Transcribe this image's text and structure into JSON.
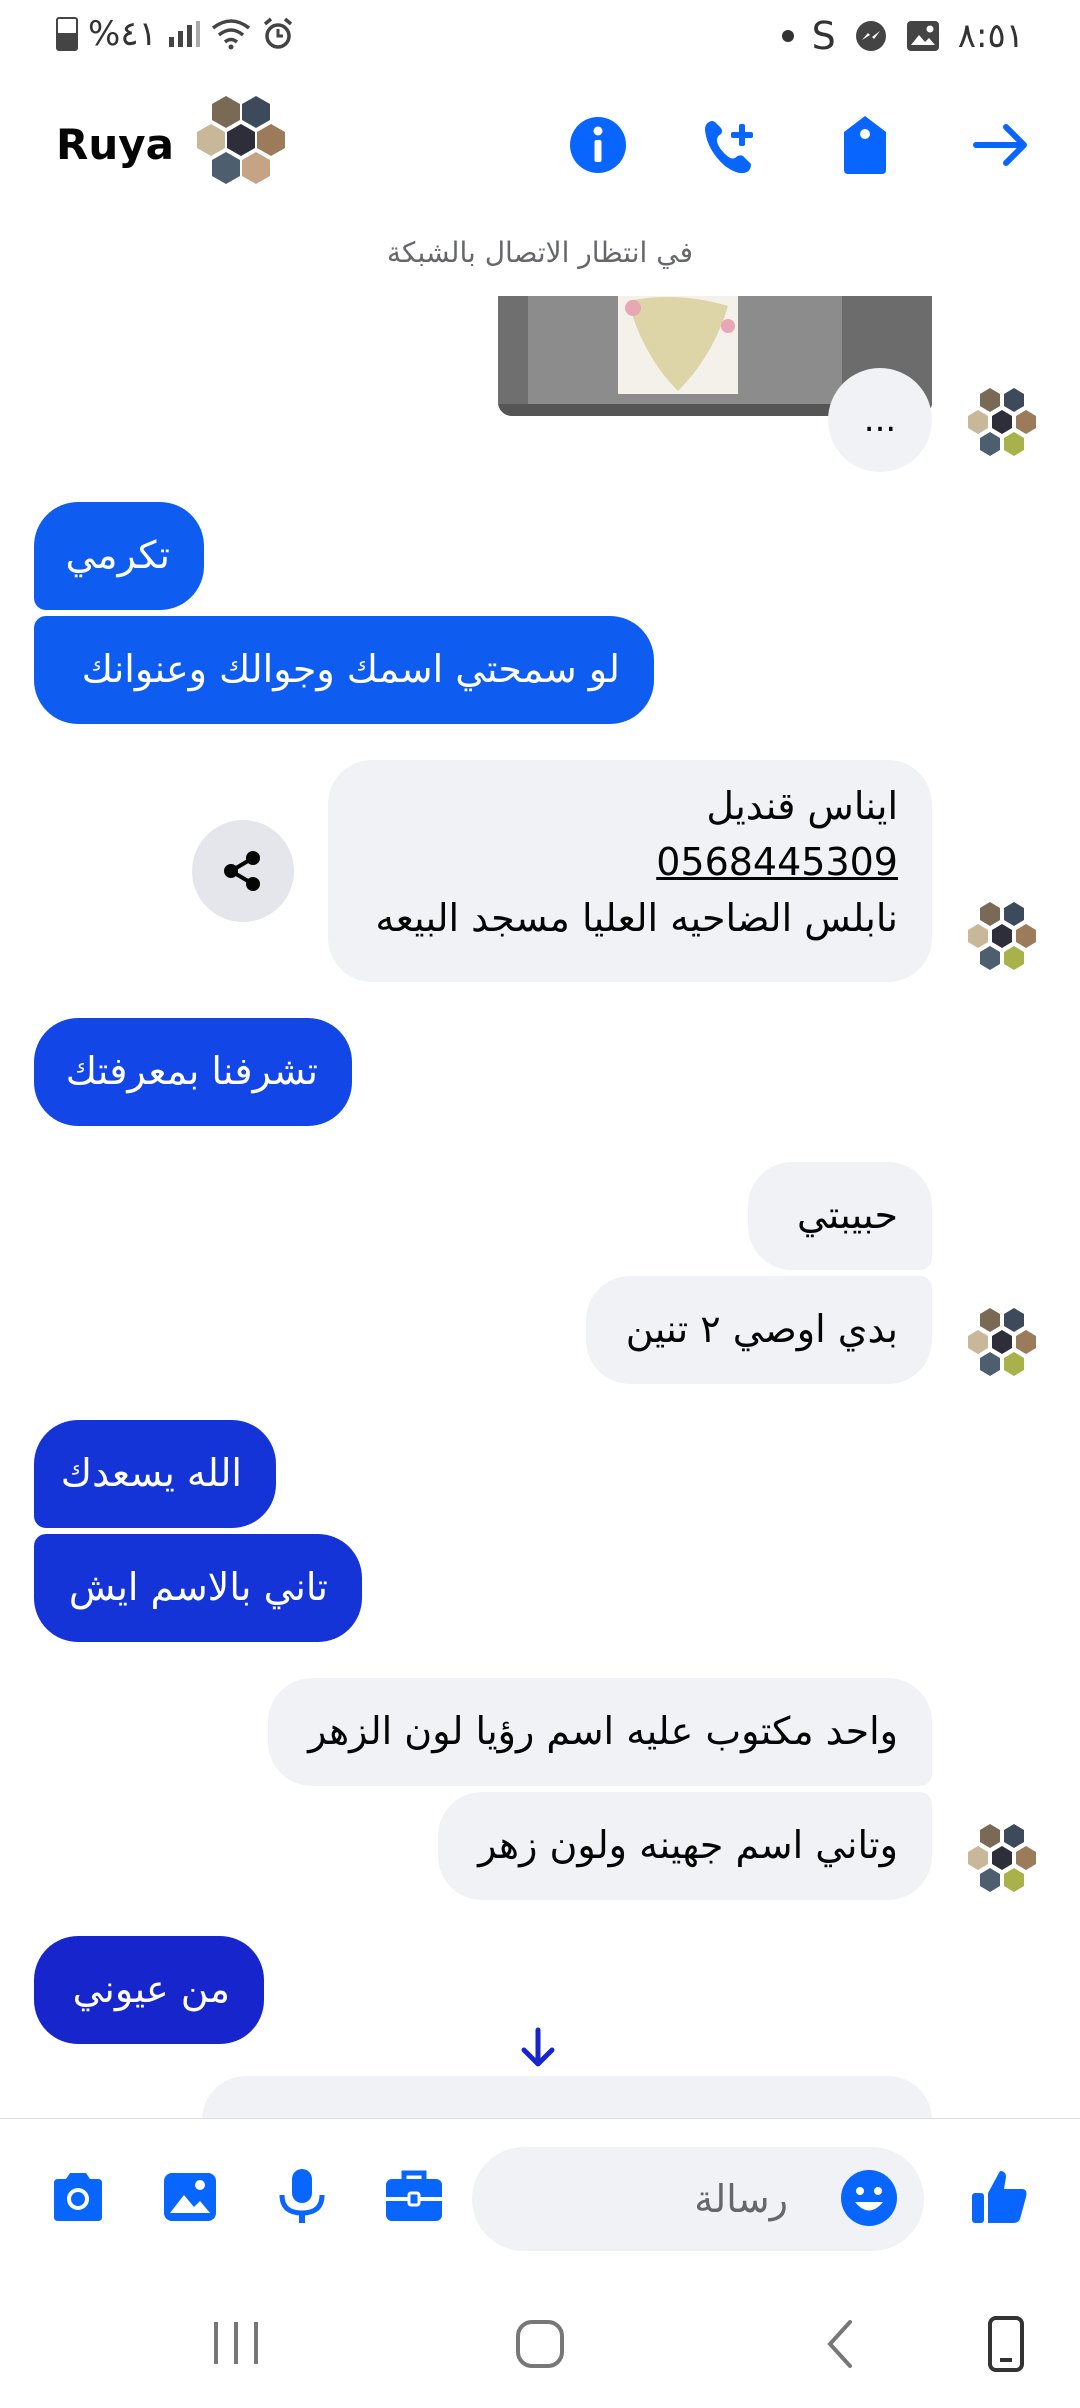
{
  "status_bar": {
    "battery_percent": "%٤١",
    "time": "٨:٥١",
    "notification_letter": "S"
  },
  "header": {
    "contact_name": "Ruya",
    "connection_status": "في انتظار الاتصال بالشبكة"
  },
  "messages": [
    {
      "sender": "them",
      "type": "image",
      "more_label": "..."
    },
    {
      "sender": "me",
      "text": "تكرمي"
    },
    {
      "sender": "me",
      "text": "لو سمحتي اسمك وجوالك وعنوانك"
    },
    {
      "sender": "them",
      "lines": [
        "ايناس قنديل",
        "0568445309",
        "نابلس الضاحيه العليا مسجد البيعه"
      ]
    },
    {
      "sender": "me",
      "text": "تشرفنا بمعرفتك"
    },
    {
      "sender": "them",
      "text": "حبيبتي"
    },
    {
      "sender": "them",
      "text": "بدي اوصي ٢ تنين"
    },
    {
      "sender": "me",
      "text": "الله يسعدك"
    },
    {
      "sender": "me",
      "text": "تاني بالاسم ايش"
    },
    {
      "sender": "them",
      "text": "واحد مكتوب عليه اسم رؤيا لون الزهر"
    },
    {
      "sender": "them",
      "text": "وتاني اسم جهينه ولون زهر"
    },
    {
      "sender": "me",
      "text": "من عيوني"
    }
  ],
  "composer": {
    "placeholder": "رسالة"
  },
  "colors": {
    "accent": "#0866ff",
    "bubble_them": "#f0f2f5"
  }
}
